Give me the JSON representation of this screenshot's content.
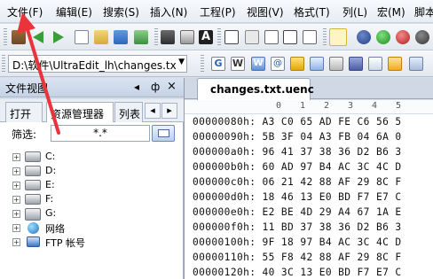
{
  "menu": {
    "items": [
      "文件(F)",
      "编辑(E)",
      "搜索(S)",
      "插入(N)",
      "工程(P)",
      "视图(V)",
      "格式(T)",
      "列(L)",
      "宏(M)",
      "脚本"
    ]
  },
  "toolbar": {
    "path_value": "D:\\软件\\UltraEdit_lh\\changes.tx",
    "dropdown_arrow": "▼",
    "search_buttons": [
      "G",
      "W",
      "W",
      "@"
    ]
  },
  "left_panel": {
    "title": "文件视图",
    "title_controls": [
      "◂",
      "ф",
      "×"
    ],
    "tabs": [
      "打开",
      "资源管理器",
      "列表"
    ],
    "tab_nav": [
      "◂",
      "▸"
    ],
    "filter_label": "筛选:",
    "filter_value": "*.*",
    "tree": [
      {
        "expander": "+",
        "label": "C:"
      },
      {
        "expander": "+",
        "label": "D:"
      },
      {
        "expander": "+",
        "label": "E:"
      },
      {
        "expander": "+",
        "label": "F:"
      },
      {
        "expander": "+",
        "label": "G:"
      },
      {
        "expander": "+",
        "label": "网络"
      },
      {
        "expander": "+",
        "label": "FTP 帐号"
      }
    ]
  },
  "editor": {
    "tab_label": "changes.txt.uenc",
    "ruler": [
      "0",
      "1",
      "2",
      "3",
      "4",
      "5"
    ],
    "rows": [
      {
        "addr": "00000080h:",
        "bytes": "A3 C0 65 AD FE C6 56 5"
      },
      {
        "addr": "00000090h:",
        "bytes": "5B 3F 04 A3 FB 04 6A 0"
      },
      {
        "addr": "000000a0h:",
        "bytes": "96 41 37 38 36 D2 B6 3"
      },
      {
        "addr": "000000b0h:",
        "bytes": "60 AD 97 B4 AC 3C 4C D"
      },
      {
        "addr": "000000c0h:",
        "bytes": "06 21 42 88 AF 29 8C F"
      },
      {
        "addr": "000000d0h:",
        "bytes": "18 46 13 E0 BD F7 E7 C"
      },
      {
        "addr": "000000e0h:",
        "bytes": "E2 BE 4D 29 A4 67 1A E"
      },
      {
        "addr": "000000f0h:",
        "bytes": "11 BD 37 38 36 D2 B6 3"
      },
      {
        "addr": "00000100h:",
        "bytes": "9F 18 97 B4 AC 3C 4C D"
      },
      {
        "addr": "00000110h:",
        "bytes": "55 F8 42 88 AF 29 8C F"
      },
      {
        "addr": "00000120h:",
        "bytes": "40 3C 13 E0 BD F7 E7 C"
      }
    ]
  },
  "colors": {
    "annotation_arrow": "#e8343a",
    "menu_bg": "#eef2f7",
    "panel_header": "#cdd9ea"
  }
}
